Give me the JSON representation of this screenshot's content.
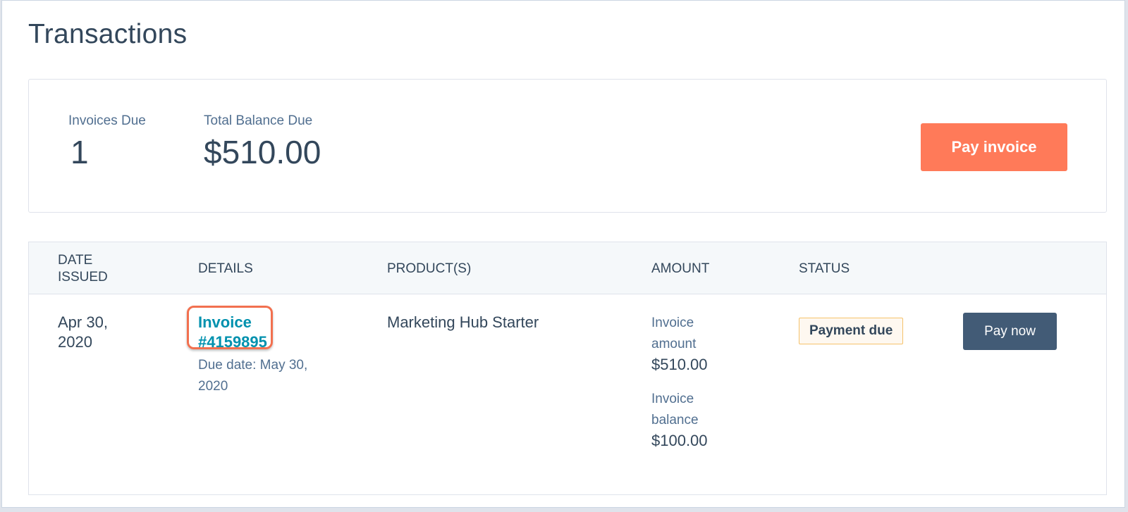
{
  "page": {
    "title": "Transactions"
  },
  "summary": {
    "invoices_due_label": "Invoices Due",
    "invoices_due_value": "1",
    "total_balance_label": "Total Balance Due",
    "total_balance_value": "$510.00",
    "pay_invoice_label": "Pay invoice"
  },
  "table": {
    "headers": {
      "date_issued": "DATE ISSUED",
      "details": "DETAILS",
      "products": "PRODUCT(S)",
      "amount": "AMOUNT",
      "status": "STATUS"
    },
    "rows": [
      {
        "date_issued": "Apr 30, 2020",
        "invoice_link": "Invoice #4159895",
        "due_date": "Due date: May 30, 2020",
        "product": "Marketing Hub Starter",
        "invoice_amount_label": "Invoice amount",
        "invoice_amount_value": "$510.00",
        "invoice_balance_label": "Invoice balance",
        "invoice_balance_value": "$100.00",
        "status": "Payment due",
        "action_label": "Pay now"
      }
    ]
  },
  "colors": {
    "accent": "#ff7a59",
    "link": "#0091ae",
    "primary_button": "#425b76",
    "highlight_ring": "#f2704f",
    "status_badge_border": "#f5c26b"
  }
}
